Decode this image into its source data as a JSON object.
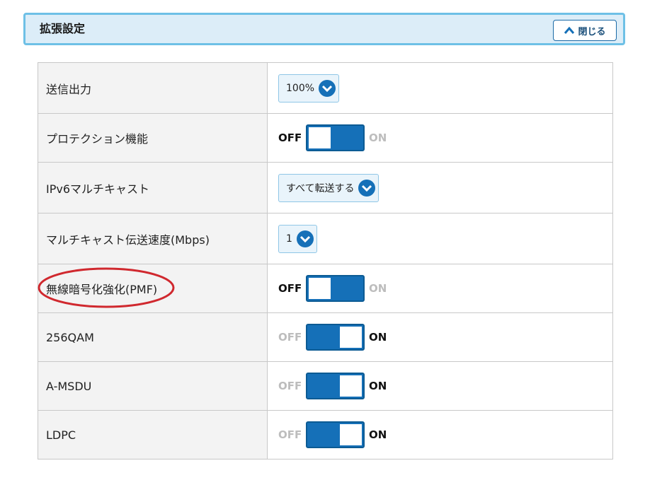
{
  "panel": {
    "title": "拡張設定",
    "close_label": "閉じる"
  },
  "rows": [
    {
      "label": "送信出力",
      "type": "select",
      "value": "100%"
    },
    {
      "label": "プロテクション機能",
      "type": "toggle",
      "off_label": "OFF",
      "on_label": "ON",
      "state": "off"
    },
    {
      "label": "IPv6マルチキャスト",
      "type": "select",
      "value": "すべて転送する"
    },
    {
      "label": "マルチキャスト伝送速度(Mbps)",
      "type": "select",
      "value": "1"
    },
    {
      "label": "無線暗号化強化(PMF)",
      "type": "toggle",
      "off_label": "OFF",
      "on_label": "ON",
      "state": "off"
    },
    {
      "label": "256QAM",
      "type": "toggle",
      "off_label": "OFF",
      "on_label": "ON",
      "state": "on"
    },
    {
      "label": "A-MSDU",
      "type": "toggle",
      "off_label": "OFF",
      "on_label": "ON",
      "state": "on"
    },
    {
      "label": "LDPC",
      "type": "toggle",
      "off_label": "OFF",
      "on_label": "ON",
      "state": "on"
    }
  ],
  "annotation": {
    "highlight_color": "#d0282e"
  },
  "colors": {
    "accent": "#1570b8",
    "header_bg": "#dcedf8",
    "header_border": "#6ec0e6"
  }
}
